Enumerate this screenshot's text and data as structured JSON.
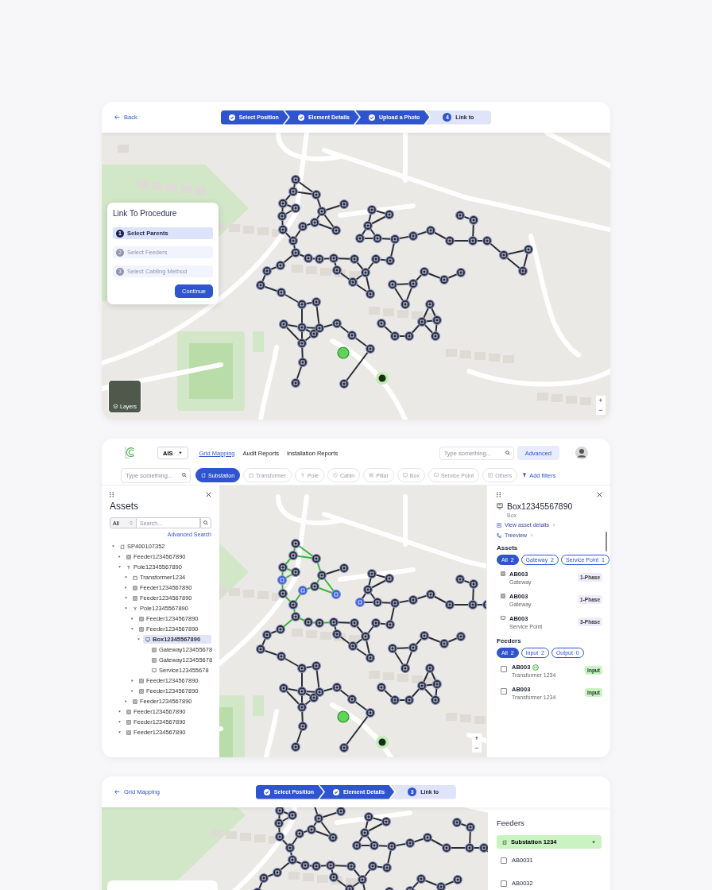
{
  "link_screen": {
    "back": "Back",
    "steps": [
      {
        "label": "Select Position",
        "completed": true
      },
      {
        "label": "Element Details",
        "completed": true
      },
      {
        "label": "Upload a Photo",
        "completed": true
      },
      {
        "label": "Link to",
        "completed": false,
        "number": "4"
      }
    ],
    "procedure": {
      "title": "Link To Procedure",
      "steps": [
        {
          "number": "1",
          "label": "Select Parents",
          "selected": true
        },
        {
          "number": "2",
          "label": "Select Feeders",
          "selected": false
        },
        {
          "number": "3",
          "label": "Select Cabling Method",
          "selected": false
        }
      ],
      "button": "Continue"
    },
    "layers": "Layers",
    "zoom": [
      "+",
      "−"
    ]
  },
  "grid_screen": {
    "app_select": "AIS",
    "nav": [
      {
        "label": "Grid Mapping",
        "selected": true
      },
      {
        "label": "Audit Reports",
        "selected": false
      },
      {
        "label": "Installation Reports",
        "selected": false
      }
    ],
    "search": {
      "placeholder": "Type something..."
    },
    "advanced": "Advanced",
    "filter_search": {
      "placeholder": "Type something..."
    },
    "filters": [
      {
        "label": "Substation",
        "kind": "substation",
        "selected": true
      },
      {
        "label": "Transformer",
        "kind": "transformer",
        "selected": false
      },
      {
        "label": "Pole",
        "kind": "pole",
        "selected": false
      },
      {
        "label": "Cabin",
        "kind": "cabin",
        "selected": false
      },
      {
        "label": "Pillar",
        "kind": "pillar",
        "selected": false
      },
      {
        "label": "Box",
        "kind": "box",
        "selected": false
      },
      {
        "label": "Service Point",
        "kind": "service",
        "selected": false
      },
      {
        "label": "Others",
        "kind": "others",
        "selected": false
      }
    ],
    "add_filters": "Add filters",
    "assets_panel": {
      "title": "Assets",
      "type_select": "All",
      "search": {
        "placeholder": "Search..."
      },
      "advanced_search": "Advanced Search",
      "tree": [
        {
          "label": "SP400107352",
          "kind": "substation",
          "expanded": true,
          "selected": false,
          "children": [
            {
              "label": "Feeder1234567890",
              "kind": "feeder",
              "expanded": false,
              "selected": false
            },
            {
              "label": "Pole12345567890",
              "kind": "pole",
              "expanded": true,
              "selected": false,
              "children": [
                {
                  "label": "Transformer1234",
                  "kind": "transformer",
                  "expanded": true,
                  "selected": false
                },
                {
                  "label": "Feeder1234567890",
                  "kind": "feeder",
                  "expanded": false,
                  "selected": false
                },
                {
                  "label": "Feeder1234567890",
                  "kind": "feeder",
                  "expanded": true,
                  "selected": false
                },
                {
                  "label": "Pole12345567890",
                  "kind": "pole",
                  "expanded": true,
                  "selected": false,
                  "children": [
                    {
                      "label": "Feeder1234567890",
                      "kind": "feeder",
                      "expanded": false,
                      "selected": false
                    },
                    {
                      "label": "Feeder1234567890",
                      "kind": "feeder",
                      "expanded": true,
                      "selected": false,
                      "children": [
                        {
                          "label": "Box12345567890",
                          "kind": "box",
                          "expanded": true,
                          "selected": true,
                          "children": [
                            {
                              "label": "Gateway123455678",
                              "kind": "gateway",
                              "selected": false
                            },
                            {
                              "label": "Gateway123455678",
                              "kind": "gateway",
                              "selected": false
                            },
                            {
                              "label": "Service123455678",
                              "kind": "service",
                              "selected": false
                            }
                          ]
                        }
                      ]
                    },
                    {
                      "label": "Feeder1234567890",
                      "kind": "feeder",
                      "expanded": false,
                      "selected": false
                    },
                    {
                      "label": "Feeder1234567890",
                      "kind": "feeder",
                      "expanded": false,
                      "selected": false
                    }
                  ]
                },
                {
                  "label": "Feeder1234567890",
                  "kind": "feeder",
                  "expanded": false,
                  "selected": false
                }
              ]
            },
            {
              "label": "Feeder1234567890",
              "kind": "feeder",
              "expanded": true,
              "selected": false
            },
            {
              "label": "Feeder1234567890",
              "kind": "feeder",
              "expanded": true,
              "selected": false
            },
            {
              "label": "Feeder1234567890",
              "kind": "feeder",
              "expanded": true,
              "selected": false
            }
          ]
        }
      ]
    },
    "details_panel": {
      "title": "Box12345567890",
      "subtitle": "Box",
      "links": [
        "View asset details",
        "Treeview"
      ],
      "assets_heading": "Assets",
      "asset_filters": [
        {
          "label": "All",
          "count": "2",
          "selected": true
        },
        {
          "label": "Gateway",
          "count": "2",
          "selected": false
        },
        {
          "label": "Service Point",
          "count": "1",
          "selected": false
        }
      ],
      "assets": [
        {
          "code": "AB003",
          "type": "Gateway",
          "phase": "1-Phase",
          "kind": "gateway"
        },
        {
          "code": "AB003",
          "type": "Gateway",
          "phase": "1-Phase",
          "kind": "gateway"
        },
        {
          "code": "AB003",
          "type": "Service Point",
          "phase": "3-Phase",
          "kind": "service"
        }
      ],
      "feeders_heading": "Feeders",
      "feeder_filters": [
        {
          "label": "All",
          "count": "2",
          "selected": true
        },
        {
          "label": "Input",
          "count": "2",
          "selected": false
        },
        {
          "label": "Output",
          "count": "0",
          "selected": false
        }
      ],
      "feeders": [
        {
          "code": "AB003",
          "name": "Transformer 1234",
          "tag": "Input",
          "checked": false,
          "linked": true
        },
        {
          "code": "AB003",
          "name": "Transformer 1234",
          "tag": "Input",
          "checked": false,
          "linked": false
        }
      ]
    },
    "zoom": [
      "+",
      "−"
    ]
  },
  "feeder_screen": {
    "back": "Grid Mapping",
    "steps": [
      {
        "label": "Select Position",
        "completed": true
      },
      {
        "label": "Element Details",
        "completed": true
      },
      {
        "label": "Link to",
        "completed": false,
        "number": "3"
      }
    ],
    "feeders_panel": {
      "title": "Feeders",
      "substation": "Substation 1234",
      "items": [
        {
          "code": "AB0031",
          "checked": false
        },
        {
          "code": "AB0032",
          "checked": false
        }
      ]
    }
  }
}
